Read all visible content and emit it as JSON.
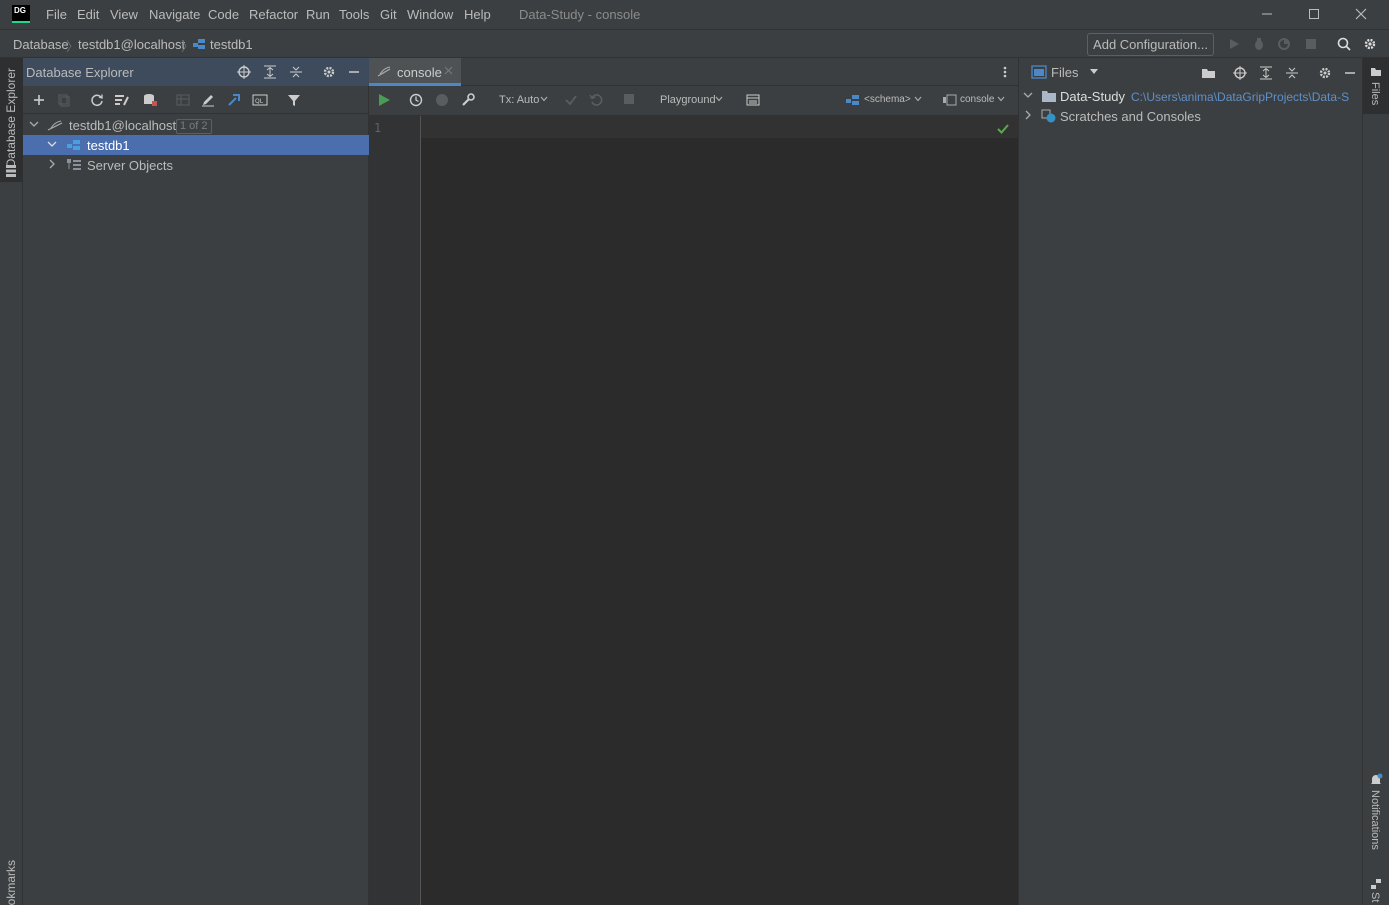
{
  "app": {
    "logo_text": "DG",
    "window_title": "Data-Study - console"
  },
  "menu": [
    "File",
    "Edit",
    "View",
    "Navigate",
    "Code",
    "Refactor",
    "Run",
    "Tools",
    "Git",
    "Window",
    "Help"
  ],
  "breadcrumb": {
    "items": [
      "Database",
      "testdb1@localhost",
      "testdb1"
    ],
    "run_config_label": "Add Configuration..."
  },
  "left_stripe": {
    "top_tab": "Database Explorer",
    "bottom_tab": "okmarks"
  },
  "db_explorer": {
    "title": "Database Explorer",
    "tree": {
      "root": {
        "label": "testdb1@localhost",
        "badge": "1 of 2"
      },
      "children": [
        {
          "label": "testdb1",
          "selected": true
        },
        {
          "label": "Server Objects",
          "selected": false
        }
      ]
    }
  },
  "editor": {
    "tab_label": "console",
    "toolbar": {
      "tx_label": "Tx: Auto",
      "playground_label": "Playground",
      "schema_label": "<schema>",
      "session_label": "console"
    },
    "line_numbers": [
      "1"
    ]
  },
  "files_panel": {
    "title": "Files",
    "tree": [
      {
        "label": "Data-Study",
        "path": "C:\\Users\\anima\\DataGripProjects\\Data-S"
      },
      {
        "label": "Scratches and Consoles",
        "path": ""
      }
    ]
  },
  "right_stripe": {
    "top_tab": "Files",
    "bottom_tab": "Notifications",
    "bottom_tab2": "St"
  },
  "colors": {
    "accent_blue": "#4a88c7",
    "selection": "#4b6eaf",
    "run_green": "#499c54",
    "check_green": "#5ca64e"
  }
}
